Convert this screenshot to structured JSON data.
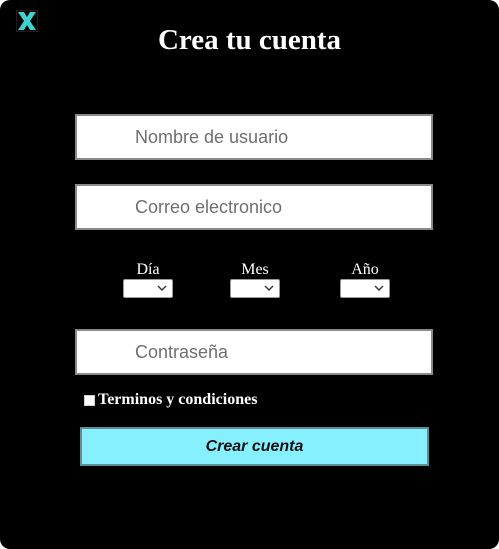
{
  "colors": {
    "background": "#000000",
    "accent": "#86f0ff",
    "close_icon": "#3fd3cf"
  },
  "header": {
    "close_icon": "close-icon",
    "title": "Crea tu cuenta"
  },
  "form": {
    "username": {
      "placeholder": "Nombre de usuario",
      "value": ""
    },
    "email": {
      "placeholder": "Correo electronico",
      "value": ""
    },
    "birthdate": {
      "day_label": "Día",
      "month_label": "Mes",
      "year_label": "Año",
      "day_value": "",
      "month_value": "",
      "year_value": ""
    },
    "password": {
      "placeholder": "Contraseña",
      "value": ""
    },
    "terms": {
      "label": "Terminos y condiciones",
      "checked": false
    },
    "submit_label": "Crear cuenta"
  }
}
